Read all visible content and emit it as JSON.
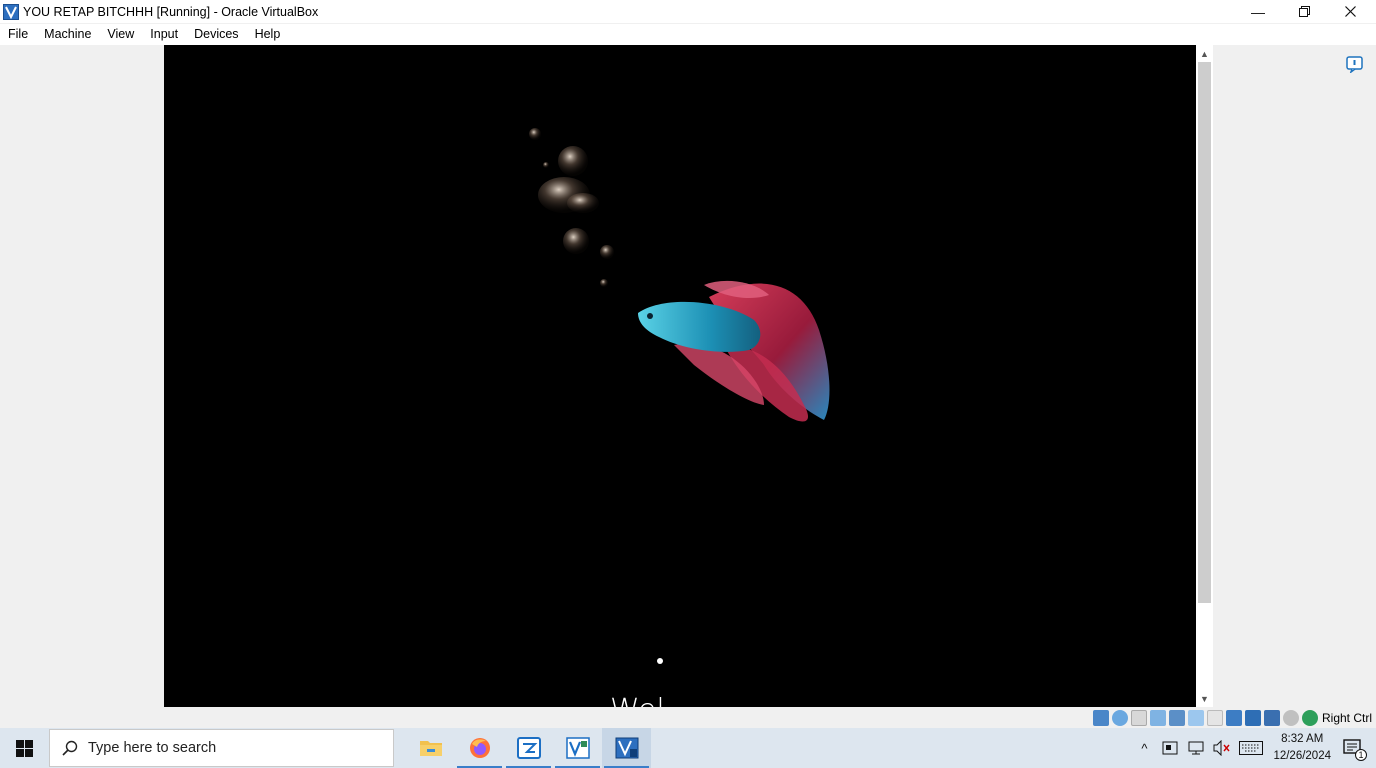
{
  "window": {
    "title": "YOU RETAP BITCHHH [Running] - Oracle VirtualBox",
    "minimize_icon": "minimize-icon",
    "restore_icon": "restore-icon",
    "close_icon": "close-icon"
  },
  "menu": [
    "File",
    "Machine",
    "View",
    "Input",
    "Devices",
    "Help"
  ],
  "vm": {
    "welcome_text": "Wel",
    "scene": "betta fish with bubbles on black background"
  },
  "statusbar": {
    "icons": [
      "hard-disk-icon",
      "optical-drive-icon",
      "floppy-icon",
      "audio-icon",
      "network-icon",
      "usb-icon",
      "shared-folders-icon",
      "display-icon",
      "recording-icon",
      "cpu-icon",
      "mouse-integration-icon",
      "keyboard-icon"
    ],
    "host_key": "Right Ctrl"
  },
  "taskbar": {
    "search_placeholder": "Type here to search",
    "apps": [
      "file-explorer-icon",
      "firefox-icon",
      "app-icon",
      "virtualbox-manager-icon",
      "virtualbox-vm-icon"
    ],
    "time": "8:32 AM",
    "date": "12/26/2024",
    "notification_count": "1"
  }
}
